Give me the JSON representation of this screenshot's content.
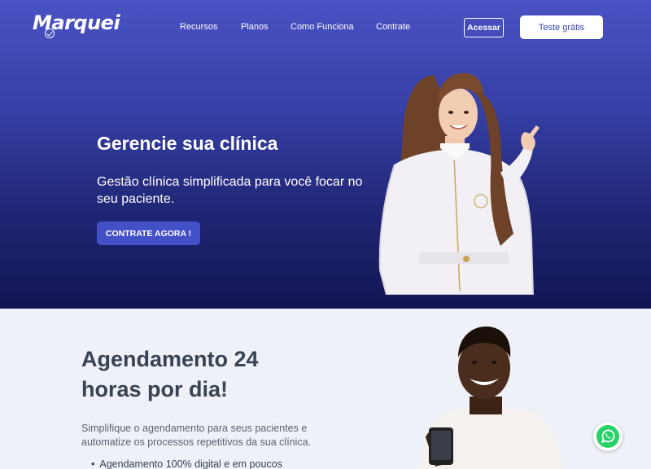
{
  "brand": {
    "name": "Marquei"
  },
  "nav": {
    "items": [
      "Recursos",
      "Planos",
      "Como Funciona",
      "Contrate"
    ]
  },
  "header": {
    "login_label": "Acessar",
    "trial_label": "Teste grátis"
  },
  "hero": {
    "title": "Gerencie sua clínica",
    "subtitle": "Gestão clínica simplificada para você focar no seu paciente.",
    "cta_label": "CONTRATE AGORA !"
  },
  "scheduling": {
    "title": "Agendamento 24 horas por dia!",
    "description": "Simplifique o agendamento para seus pacientes e automatize os processos repetitivos da sua clínica.",
    "features": [
      "Agendamento 100% digital e em poucos"
    ]
  },
  "icons": {
    "whatsapp": "whatsapp-icon",
    "logo_check": "check-circle-icon"
  },
  "colors": {
    "primary": "#3a44b5",
    "hero_top": "#4a52c4",
    "hero_bottom": "#121653",
    "whatsapp": "#25d366"
  }
}
